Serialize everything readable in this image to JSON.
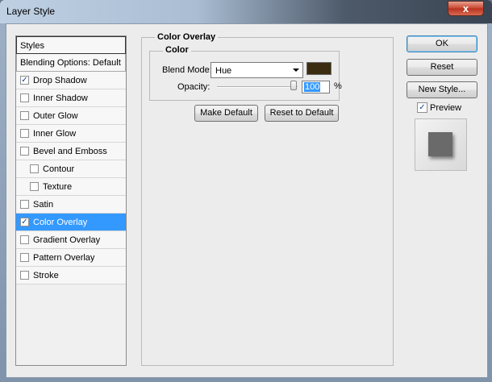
{
  "window": {
    "title": "Layer Style",
    "close_glyph": "x"
  },
  "sidebar": {
    "header": "Styles",
    "blending_options": "Blending Options: Default",
    "items": [
      {
        "label": "Drop Shadow",
        "checked": true,
        "check": "✓",
        "sub": false
      },
      {
        "label": "Inner Shadow",
        "checked": false,
        "check": "",
        "sub": false
      },
      {
        "label": "Outer Glow",
        "checked": false,
        "check": "",
        "sub": false
      },
      {
        "label": "Inner Glow",
        "checked": false,
        "check": "",
        "sub": false
      },
      {
        "label": "Bevel and Emboss",
        "checked": false,
        "check": "",
        "sub": false
      },
      {
        "label": "Contour",
        "checked": false,
        "check": "",
        "sub": true
      },
      {
        "label": "Texture",
        "checked": false,
        "check": "",
        "sub": true
      },
      {
        "label": "Satin",
        "checked": false,
        "check": "",
        "sub": false
      },
      {
        "label": "Color Overlay",
        "checked": true,
        "check": "✓",
        "sub": false,
        "selected": true
      },
      {
        "label": "Gradient Overlay",
        "checked": false,
        "check": "",
        "sub": false
      },
      {
        "label": "Pattern Overlay",
        "checked": false,
        "check": "",
        "sub": false
      },
      {
        "label": "Stroke",
        "checked": false,
        "check": "",
        "sub": false
      }
    ]
  },
  "panel": {
    "group_title": "Color Overlay",
    "subgroup_title": "Color",
    "blend_mode_label": "Blend Mode:",
    "blend_mode_value": "Hue",
    "overlay_color": "#3d2d10",
    "opacity_label": "Opacity:",
    "opacity_value": "100",
    "opacity_unit": "%",
    "make_default": "Make Default",
    "reset_default": "Reset to Default"
  },
  "actions": {
    "ok": "OK",
    "reset": "Reset",
    "new_style": "New Style...",
    "preview_label": "Preview",
    "preview_checked": true,
    "preview_check": "✓"
  },
  "colors": {
    "selection": "#3399ff",
    "swatch": "#3d2d10"
  }
}
